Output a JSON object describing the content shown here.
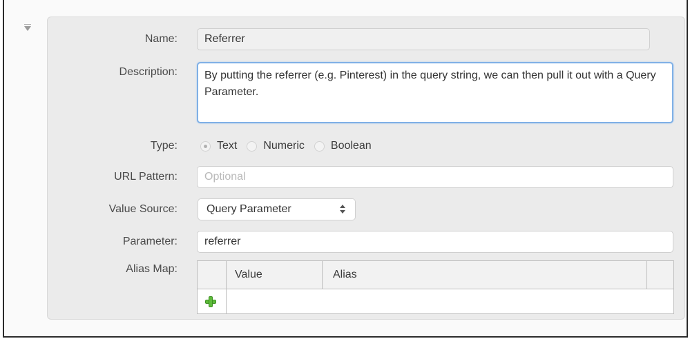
{
  "form": {
    "name_label": "Name:",
    "name_value": "Referrer",
    "description_label": "Description:",
    "description_value": "By putting the referrer (e.g. Pinterest) in the query string, we can then pull it out with a Query Parameter.",
    "type_label": "Type:",
    "type_options": [
      {
        "label": "Text",
        "selected": true
      },
      {
        "label": "Numeric",
        "selected": false
      },
      {
        "label": "Boolean",
        "selected": false
      }
    ],
    "url_pattern_label": "URL Pattern:",
    "url_pattern_value": "",
    "url_pattern_placeholder": "Optional",
    "value_source_label": "Value Source:",
    "value_source_selected": "Query Parameter",
    "parameter_label": "Parameter:",
    "parameter_value": "referrer",
    "alias_map_label": "Alias Map:",
    "alias_map_columns": [
      "Value",
      "Alias"
    ]
  },
  "colors": {
    "panel_bg": "#ebebeb",
    "focus_ring": "#7fb0e6",
    "add_icon": "#5dbb3a"
  }
}
